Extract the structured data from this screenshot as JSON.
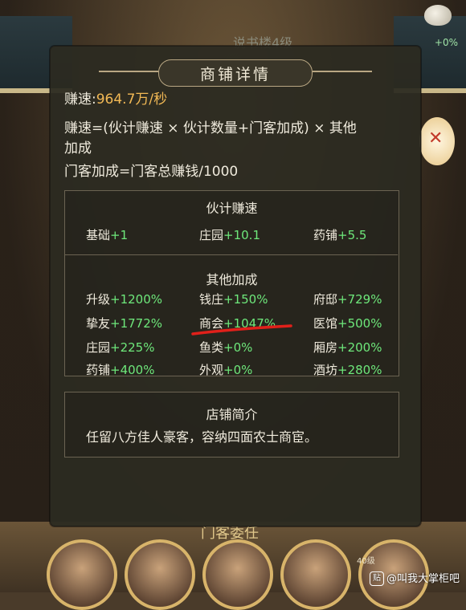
{
  "background": {
    "top_label": "说书楼4级",
    "coin_pct": "+0%",
    "bottom_title": "门客委任",
    "bottom_counter": "40级",
    "watermark": "@叫我大掌柜吧",
    "watermark_icon": "贴"
  },
  "dialog": {
    "title": "商铺详情",
    "earn_speed_label": "赚速:",
    "earn_speed_value": "964.7万/秒",
    "formula_line1": "赚速=(伙计赚速 × 伙计数量+门客加成) × 其他",
    "formula_line2": "加成",
    "guest_bonus_formula": "门客加成=门客总赚钱/1000",
    "staff_section": {
      "title": "伙计赚速",
      "items": [
        {
          "label": "基础",
          "value": "+1"
        },
        {
          "label": "庄园",
          "value": "+10.1"
        },
        {
          "label": "药铺",
          "value": "+5.5"
        }
      ]
    },
    "other_section": {
      "title": "其他加成",
      "items": [
        {
          "label": "升级",
          "value": "+1200%"
        },
        {
          "label": "钱庄",
          "value": "+150%"
        },
        {
          "label": "府邸",
          "value": "+729%"
        },
        {
          "label": "挚友",
          "value": "+1772%"
        },
        {
          "label": "商会",
          "value": "+1047%"
        },
        {
          "label": "医馆",
          "value": "+500%"
        },
        {
          "label": "庄园",
          "value": "+225%"
        },
        {
          "label": "鱼类",
          "value": "+0%"
        },
        {
          "label": "厢房",
          "value": "+200%"
        },
        {
          "label": "药铺",
          "value": "+400%"
        },
        {
          "label": "外观",
          "value": "+0%"
        },
        {
          "label": "酒坊",
          "value": "+280%"
        }
      ]
    },
    "intro_section": {
      "title": "店铺简介",
      "text": "任留八方佳人豪客，容纳四面农士商宦。"
    },
    "highlight_color": "#e0201a"
  }
}
